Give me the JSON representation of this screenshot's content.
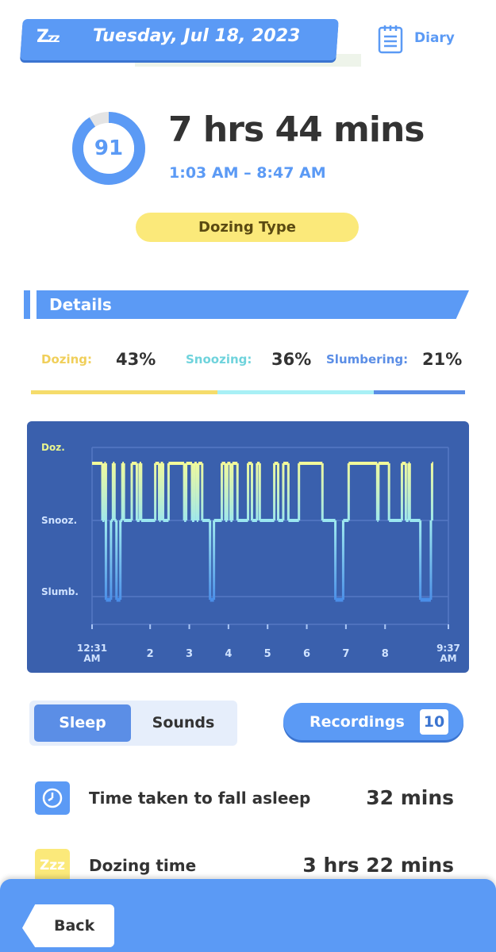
{
  "header": {
    "date": "Tuesday, Jul 18, 2023",
    "zzz_icon": "zzz-icon",
    "diary_label": "Diary",
    "diary_icon": "notepad-icon"
  },
  "summary": {
    "score": "91",
    "score_fraction": 0.91,
    "duration": "7 hrs 44 mins",
    "time_range": "1:03 AM – 8:47 AM",
    "sleep_type": "Dozing Type"
  },
  "details": {
    "title": "Details",
    "stats": [
      {
        "label": "Dozing:",
        "value": "43%",
        "fraction": 0.43,
        "color": "#f5dc6b"
      },
      {
        "label": "Snoozing:",
        "value": "36%",
        "fraction": 0.36,
        "color": "#a8f0f5"
      },
      {
        "label": "Slumbering:",
        "value": "21%",
        "fraction": 0.21,
        "color": "#5b8ee6"
      }
    ]
  },
  "chart_data": {
    "type": "line",
    "y_categories": [
      "Doz.",
      "Snooz.",
      "Slumb."
    ],
    "x_tick_labels": [
      "12:31\nAM",
      "2",
      "3",
      "4",
      "5",
      "6",
      "7",
      "8",
      "9:37\nAM"
    ],
    "x_range_hours": [
      0.5167,
      9.6167
    ],
    "grid": true,
    "colors": {
      "dozing": "#f2fa9a",
      "snoozing": "#9be7f0",
      "slumbering": "#4a8ee8"
    },
    "segments": [
      {
        "start": 0.5167,
        "end": 0.78,
        "stage": "Doz."
      },
      {
        "start": 0.78,
        "end": 0.83,
        "stage": "Snooz."
      },
      {
        "start": 0.83,
        "end": 0.87,
        "stage": "Doz."
      },
      {
        "start": 0.87,
        "end": 1.0,
        "stage": "Slumb."
      },
      {
        "start": 1.0,
        "end": 1.05,
        "stage": "Snooz."
      },
      {
        "start": 1.05,
        "end": 1.09,
        "stage": "Doz."
      },
      {
        "start": 1.09,
        "end": 1.14,
        "stage": "Snooz."
      },
      {
        "start": 1.14,
        "end": 1.24,
        "stage": "Slumb."
      },
      {
        "start": 1.24,
        "end": 1.29,
        "stage": "Snooz."
      },
      {
        "start": 1.29,
        "end": 1.33,
        "stage": "Doz."
      },
      {
        "start": 1.33,
        "end": 1.53,
        "stage": "Snooz."
      },
      {
        "start": 1.53,
        "end": 1.66,
        "stage": "Doz."
      },
      {
        "start": 1.66,
        "end": 1.73,
        "stage": "Snooz."
      },
      {
        "start": 1.73,
        "end": 1.77,
        "stage": "Doz."
      },
      {
        "start": 1.77,
        "end": 2.13,
        "stage": "Snooz."
      },
      {
        "start": 2.13,
        "end": 2.23,
        "stage": "Doz."
      },
      {
        "start": 2.23,
        "end": 2.27,
        "stage": "Snooz."
      },
      {
        "start": 2.27,
        "end": 2.33,
        "stage": "Doz."
      },
      {
        "start": 2.33,
        "end": 2.47,
        "stage": "Snooz."
      },
      {
        "start": 2.47,
        "end": 2.87,
        "stage": "Doz."
      },
      {
        "start": 2.87,
        "end": 2.92,
        "stage": "Snooz."
      },
      {
        "start": 2.92,
        "end": 3.07,
        "stage": "Doz."
      },
      {
        "start": 3.07,
        "end": 3.13,
        "stage": "Snooz."
      },
      {
        "start": 3.13,
        "end": 3.19,
        "stage": "Doz."
      },
      {
        "start": 3.19,
        "end": 3.23,
        "stage": "Snooz."
      },
      {
        "start": 3.23,
        "end": 3.33,
        "stage": "Doz."
      },
      {
        "start": 3.33,
        "end": 3.53,
        "stage": "Snooz."
      },
      {
        "start": 3.53,
        "end": 3.63,
        "stage": "Slumb."
      },
      {
        "start": 3.63,
        "end": 3.83,
        "stage": "Snooz."
      },
      {
        "start": 3.83,
        "end": 3.92,
        "stage": "Doz."
      },
      {
        "start": 3.92,
        "end": 3.97,
        "stage": "Snooz."
      },
      {
        "start": 3.97,
        "end": 4.05,
        "stage": "Doz."
      },
      {
        "start": 4.05,
        "end": 4.1,
        "stage": "Snooz."
      },
      {
        "start": 4.1,
        "end": 4.23,
        "stage": "Doz."
      },
      {
        "start": 4.23,
        "end": 4.5,
        "stage": "Snooz."
      },
      {
        "start": 4.5,
        "end": 4.6,
        "stage": "Doz."
      },
      {
        "start": 4.6,
        "end": 4.73,
        "stage": "Snooz."
      },
      {
        "start": 4.73,
        "end": 4.8,
        "stage": "Doz."
      },
      {
        "start": 4.8,
        "end": 5.17,
        "stage": "Snooz."
      },
      {
        "start": 5.17,
        "end": 5.27,
        "stage": "Doz."
      },
      {
        "start": 5.27,
        "end": 5.4,
        "stage": "Snooz."
      },
      {
        "start": 5.4,
        "end": 5.53,
        "stage": "Doz."
      },
      {
        "start": 5.53,
        "end": 5.8,
        "stage": "Snooz."
      },
      {
        "start": 5.8,
        "end": 6.4,
        "stage": "Doz."
      },
      {
        "start": 6.4,
        "end": 6.73,
        "stage": "Snooz."
      },
      {
        "start": 6.73,
        "end": 6.93,
        "stage": "Slumb."
      },
      {
        "start": 6.93,
        "end": 7.07,
        "stage": "Snooz."
      },
      {
        "start": 7.07,
        "end": 7.8,
        "stage": "Doz."
      },
      {
        "start": 7.8,
        "end": 7.83,
        "stage": "Snooz."
      },
      {
        "start": 7.83,
        "end": 8.1,
        "stage": "Doz."
      },
      {
        "start": 8.1,
        "end": 8.43,
        "stage": "Snooz."
      },
      {
        "start": 8.43,
        "end": 8.53,
        "stage": "Doz."
      },
      {
        "start": 8.53,
        "end": 8.6,
        "stage": "Snooz."
      },
      {
        "start": 8.6,
        "end": 8.63,
        "stage": "Doz."
      },
      {
        "start": 8.63,
        "end": 8.9,
        "stage": "Snooz."
      },
      {
        "start": 8.9,
        "end": 9.17,
        "stage": "Slumb."
      },
      {
        "start": 9.17,
        "end": 9.2,
        "stage": "Snooz."
      },
      {
        "start": 9.2,
        "end": 9.23,
        "stage": "Doz."
      }
    ]
  },
  "tabs": {
    "sleep": "Sleep",
    "sounds": "Sounds",
    "active": "Sleep"
  },
  "recordings": {
    "label": "Recordings",
    "count": "10"
  },
  "rows": [
    {
      "icon": "clock-icon",
      "label": "Time taken to fall asleep",
      "value": "32 mins"
    },
    {
      "icon": "zzz-icon",
      "label": "Dozing time",
      "value": "3 hrs 22 mins"
    }
  ],
  "footer": {
    "back_label": "Back"
  }
}
